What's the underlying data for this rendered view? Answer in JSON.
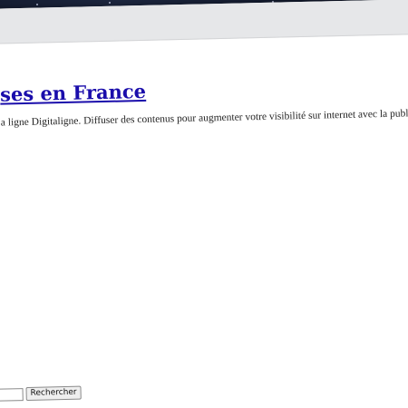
{
  "page": {
    "title": "ses en France",
    "description": "a ligne Digitaligne. Diffuser des contenus pour augmenter votre visibilité sur internet avec la publication de vos in"
  },
  "search": {
    "button_label": "Rechercher",
    "value": ""
  }
}
